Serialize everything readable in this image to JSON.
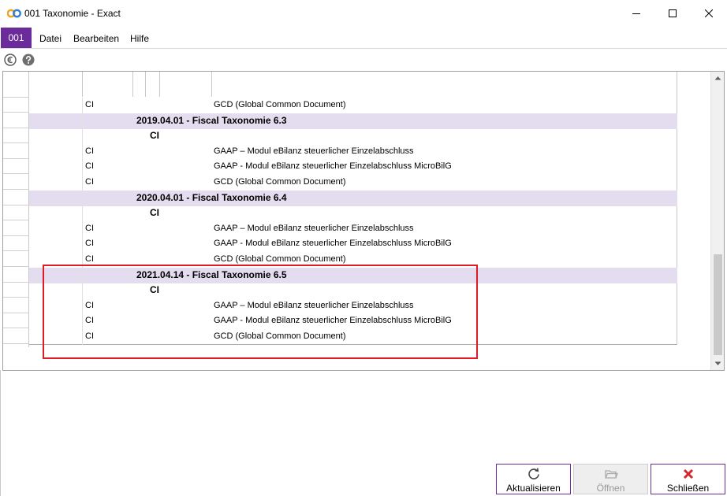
{
  "window": {
    "title": "001 Taxonomie - Exact",
    "icon": "exact-logo-icon",
    "controls": [
      "minimize-icon",
      "maximize-icon",
      "close-icon"
    ]
  },
  "menu": {
    "company": "001",
    "items": [
      "Datei",
      "Bearbeiten",
      "Hilfe"
    ]
  },
  "toolbar": {
    "icons": [
      "euro-icon",
      "help-icon"
    ]
  },
  "grid": {
    "rows": [
      {
        "type": "item",
        "code": "CI",
        "description": "GCD (Global Common Document)"
      },
      {
        "type": "taxonomy",
        "title": "2019.04.01 - Fiscal Taxonomie 6.3"
      },
      {
        "type": "group",
        "label": "CI"
      },
      {
        "type": "item",
        "code": "CI",
        "description": "GAAP – Modul eBilanz steuerlicher Einzelabschluss"
      },
      {
        "type": "item",
        "code": "CI",
        "description": "GAAP - Modul eBilanz steuerlicher Einzelabschluss MicroBilG"
      },
      {
        "type": "item",
        "code": "CI",
        "description": "GCD (Global Common Document)"
      },
      {
        "type": "taxonomy",
        "title": "2020.04.01 - Fiscal Taxonomie 6.4"
      },
      {
        "type": "group",
        "label": "CI"
      },
      {
        "type": "item",
        "code": "CI",
        "description": "GAAP – Modul eBilanz steuerlicher Einzelabschluss"
      },
      {
        "type": "item",
        "code": "CI",
        "description": "GAAP - Modul eBilanz steuerlicher Einzelabschluss MicroBilG"
      },
      {
        "type": "item",
        "code": "CI",
        "description": "GCD (Global Common Document)"
      },
      {
        "type": "taxonomy",
        "title": "2021.04.14 - Fiscal Taxonomie 6.5"
      },
      {
        "type": "group",
        "label": "CI"
      },
      {
        "type": "item",
        "code": "CI",
        "description": "GAAP – Modul eBilanz steuerlicher Einzelabschluss"
      },
      {
        "type": "item",
        "code": "CI",
        "description": "GAAP - Modul eBilanz steuerlicher Einzelabschluss MicroBilG"
      },
      {
        "type": "item",
        "code": "CI",
        "description": "GCD (Global Common Document)"
      }
    ]
  },
  "buttons": {
    "refresh": {
      "label": "Aktualisieren",
      "icon": "refresh-icon",
      "enabled": true
    },
    "open": {
      "label": "Öffnen",
      "icon": "folder-open-icon",
      "enabled": false
    },
    "close": {
      "label": "Schließen",
      "icon": "close-x-icon",
      "enabled": true
    }
  },
  "colors": {
    "accent": "#6c2b9b",
    "taxonomy_row": "#e4dcef",
    "highlight": "#e01b24"
  }
}
